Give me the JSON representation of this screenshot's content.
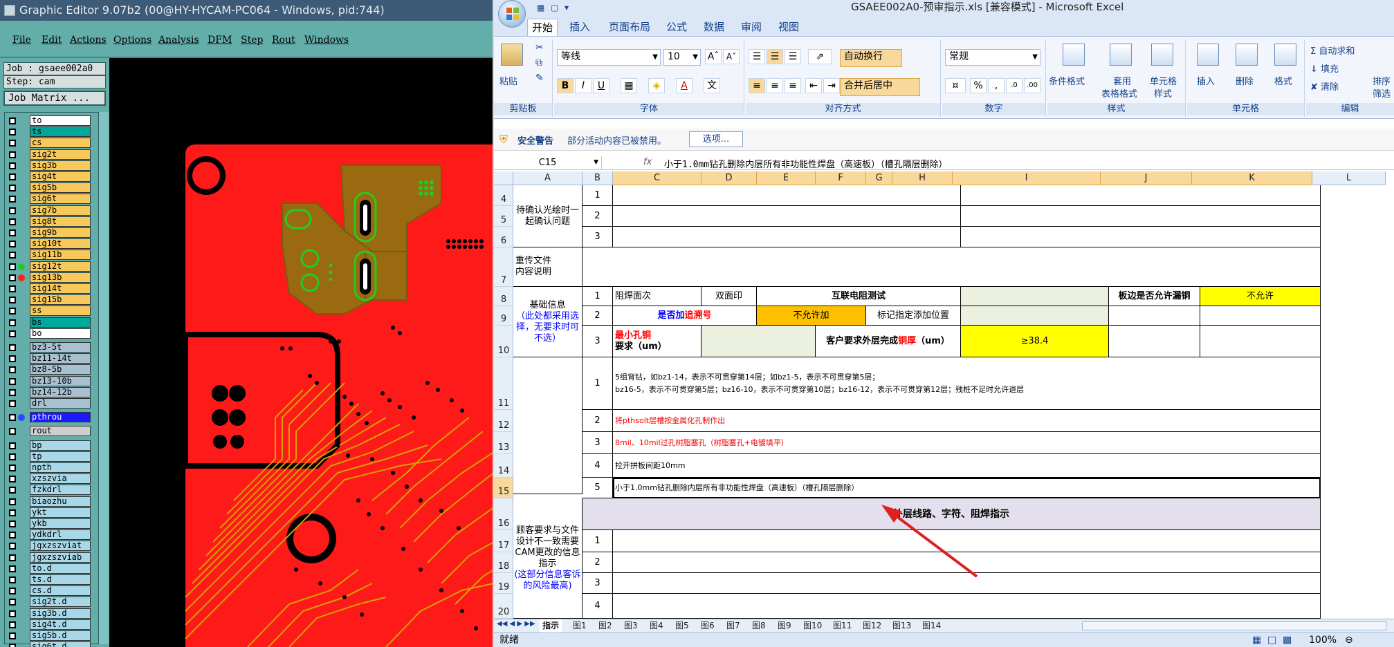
{
  "editor": {
    "title": "Graphic Editor 9.07b2 (00@HY-HYCAM-PC064 - Windows, pid:744)",
    "menu": [
      "File",
      "Edit",
      "Actions",
      "Options",
      "Analysis",
      "DFM",
      "Step",
      "Rout",
      "Windows"
    ],
    "job": "Job : gsaee002a0",
    "step": "Step: cam",
    "matrix_button": "Job Matrix ...",
    "layers": [
      {
        "name": "to",
        "color": "#ffffff"
      },
      {
        "name": "ts",
        "color": "#00a89a"
      },
      {
        "name": "cs",
        "color": "#f7c85a"
      },
      {
        "name": "sig2t",
        "color": "#f7c85a"
      },
      {
        "name": "sig3b",
        "color": "#f7c85a"
      },
      {
        "name": "sig4t",
        "color": "#f7c85a"
      },
      {
        "name": "sig5b",
        "color": "#f7c85a"
      },
      {
        "name": "sig6t",
        "color": "#f7c85a"
      },
      {
        "name": "sig7b",
        "color": "#f7c85a"
      },
      {
        "name": "sig8t",
        "color": "#f7c85a"
      },
      {
        "name": "sig9b",
        "color": "#f7c85a"
      },
      {
        "name": "sig10t",
        "color": "#f7c85a"
      },
      {
        "name": "sig11b",
        "color": "#f7c85a"
      },
      {
        "name": "sig12t",
        "color": "#f7c85a",
        "status": "#22cc22"
      },
      {
        "name": "sig13b",
        "color": "#f7c85a",
        "status": "#ff2020"
      },
      {
        "name": "sig14t",
        "color": "#f7c85a"
      },
      {
        "name": "sig15b",
        "color": "#f7c85a"
      },
      {
        "name": "ss",
        "color": "#f7c85a"
      },
      {
        "name": "bs",
        "color": "#00a89a"
      },
      {
        "name": "bo",
        "color": "#ffffff"
      },
      {
        "name": "bz3-5t",
        "color": "#a8c0d0",
        "gap": true
      },
      {
        "name": "bz11-14t",
        "color": "#a8c0d0"
      },
      {
        "name": "bz8-5b",
        "color": "#a8c0d0"
      },
      {
        "name": "bz13-10b",
        "color": "#a8c0d0"
      },
      {
        "name": "bz14-12b",
        "color": "#a8c0d0"
      },
      {
        "name": "drl",
        "color": "#a8c0d0"
      },
      {
        "name": "pthrou",
        "color": "#1a1aff",
        "status": "#2a4aff",
        "gap": true,
        "dark": true
      },
      {
        "name": "rout",
        "color": "#cfcfcf",
        "gap": true
      },
      {
        "name": "bp",
        "color": "#a8d8e8",
        "gap": true
      },
      {
        "name": "tp",
        "color": "#a8d8e8"
      },
      {
        "name": "npth",
        "color": "#a8d8e8"
      },
      {
        "name": "xzszvia",
        "color": "#a8d8e8"
      },
      {
        "name": "fzkdrl",
        "color": "#a8d8e8"
      },
      {
        "name": "biaozhu",
        "color": "#a8d8e8"
      },
      {
        "name": "ykt",
        "color": "#a8d8e8"
      },
      {
        "name": "ykb",
        "color": "#a8d8e8"
      },
      {
        "name": "ydkdrl",
        "color": "#a8d8e8"
      },
      {
        "name": "jgxzszviat",
        "color": "#a8d8e8"
      },
      {
        "name": "jgxzszviab",
        "color": "#a8d8e8"
      },
      {
        "name": "to.d",
        "color": "#a8d8e8"
      },
      {
        "name": "ts.d",
        "color": "#a8d8e8"
      },
      {
        "name": "cs.d",
        "color": "#a8d8e8"
      },
      {
        "name": "sig2t.d",
        "color": "#a8d8e8"
      },
      {
        "name": "sig3b.d",
        "color": "#a8d8e8"
      },
      {
        "name": "sig4t.d",
        "color": "#a8d8e8"
      },
      {
        "name": "sig5b.d",
        "color": "#a8d8e8"
      },
      {
        "name": "sig6t.d",
        "color": "#a8d8e8"
      }
    ]
  },
  "excel": {
    "title": "GSAEE002A0-预审指示.xls  [兼容模式] - Microsoft Excel",
    "tabs": [
      "开始",
      "插入",
      "页面布局",
      "公式",
      "数据",
      "审阅",
      "视图"
    ],
    "ribbon": {
      "paste": "粘贴",
      "clipboard": "剪贴板",
      "font_name": "等线",
      "font_size": "10",
      "font_group": "字体",
      "wrap_text": "自动换行",
      "merge_center": "合并后居中",
      "align_group": "对齐方式",
      "number_format": "常规",
      "number_group": "数字",
      "cond_format": "条件格式",
      "table_format_1": "套用",
      "table_format_2": "表格格式",
      "cell_style_1": "单元格",
      "cell_style_2": "样式",
      "styles_group": "样式",
      "insert": "插入",
      "delete": "删除",
      "format": "格式",
      "cells_group": "单元格",
      "autosum": "自动求和",
      "fill": "填充",
      "clear": "清除",
      "sort_1": "排序",
      "sort_2": "筛选",
      "edit_group": "编辑"
    },
    "security": {
      "label": "安全警告",
      "text": "部分活动内容已被禁用。",
      "button": "选项..."
    },
    "name_box": "C15",
    "fx": "fx",
    "formula": "小于1.0mm钻孔删除内层所有非功能性焊盘（高速板）（槽孔隔层删除）",
    "columns": [
      "A",
      "B",
      "C",
      "D",
      "E",
      "F",
      "G",
      "H",
      "I",
      "J",
      "K",
      "L"
    ],
    "rows": [
      "4",
      "5",
      "6",
      "7",
      "8",
      "9",
      "10",
      "11",
      "12",
      "13",
      "14",
      "15",
      "16",
      "17",
      "18",
      "19",
      "20"
    ],
    "cells": {
      "a_confirm": "待确认光绘时一起确认问题",
      "n1": "1",
      "n2": "2",
      "n3": "3",
      "n4": "4",
      "n5": "5",
      "a_reupload": "重传文件\n内容说明",
      "a_basic_1": "基础信息",
      "a_basic_2": "（此处都采用选择，无要求时可不选）",
      "solder_sides": "阻焊面次",
      "double_print": "双面印",
      "ict": "互联电阻测试",
      "edge_copper": "板边是否允许漏铜",
      "not_allowed": "不允许",
      "trace_add_a": "是否加",
      "trace_add_b": "追溯号",
      "not_allowed_add": "不允许加",
      "mark_pos": "标记指定添加位置",
      "min_hole_a": "最小孔铜",
      "min_hole_b": "要求（um）",
      "outer_cu_a": "客户要求外层完成",
      "outer_cu_b": "铜厚",
      "outer_cu_c": "（um）",
      "cu_value": "≥38.4",
      "note1": "5组背钻，如bz1-14，表示不可贯穿第14层；如bz1-5，表示不可贯穿第5层；\nbz16-5，表示不可贯穿第5层；bz16-10，表示不可贯穿第10层；bz16-12，表示不可贯穿第12层；残桩不足时允许退层",
      "note2": "将pthsolt层槽按金属化孔制作出",
      "note3": "8mil、10mil过孔树脂塞孔（树脂塞孔+电镀填平）",
      "note4": "拉开拼板间距10mm",
      "note5": "小于1.0mm钻孔删除内层所有非功能性焊盘（高速板）（槽孔隔层删除）",
      "a_diff_1": "顾客要求与文件设计不一致需要CAM更改的信息指示",
      "a_diff_2": "(这部分信息客诉的风险最高)",
      "outer_title": "外层线路、字符、阻焊指示"
    },
    "sheet_tabs": [
      "指示",
      "图1",
      "图2",
      "图3",
      "图4",
      "图5",
      "图6",
      "图7",
      "图8",
      "图9",
      "图10",
      "图11",
      "图12",
      "图13",
      "图14"
    ],
    "status": "就绪",
    "zoom": "100%",
    "colors": {
      "yellow": "#ffff00",
      "orange": "#ffc000",
      "lightgreen": "#ebf1de",
      "lavender": "#e4dfec",
      "red": "#ff0000",
      "blue": "#0000ff",
      "accent": "#15428b"
    }
  }
}
